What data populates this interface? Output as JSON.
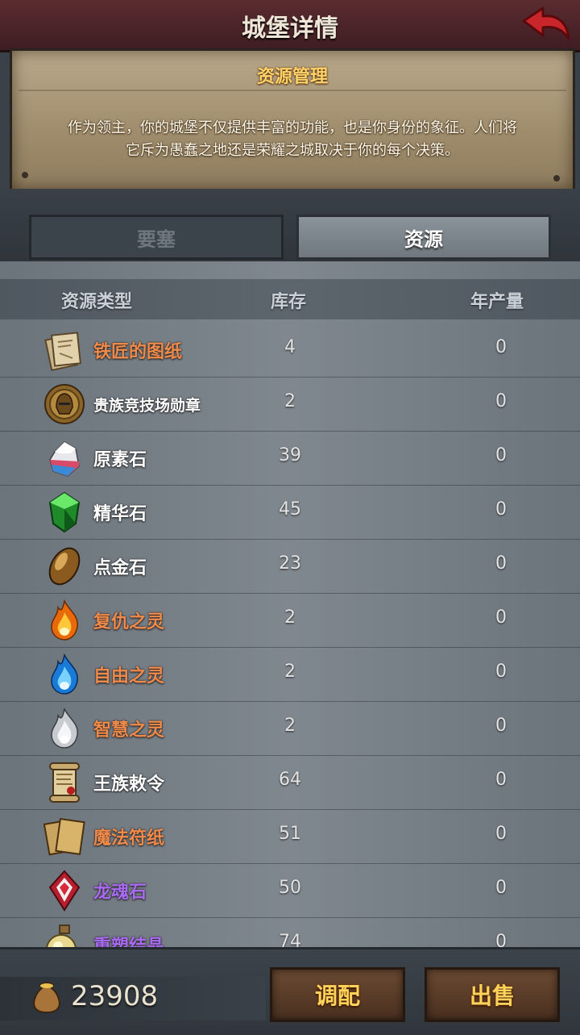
{
  "header": {
    "title": "城堡详情"
  },
  "intro": {
    "title": "资源管理",
    "line1": "作为领主，你的城堡不仅提供丰富的功能，也是你身份的象征。人们将",
    "line2": "它斥为愚蠢之地还是荣耀之城取决于你的每个决策。"
  },
  "tabs": {
    "fortress": "要塞",
    "resources": "资源",
    "active": "resources"
  },
  "table": {
    "headers": {
      "type": "资源类型",
      "stock": "库存",
      "yearly": "年产量"
    },
    "rows": [
      {
        "name": "铁匠的图纸",
        "stock": "4",
        "yearly": "0",
        "color": "#f08a4a",
        "icon": "blueprint-icon"
      },
      {
        "name": "贵族竞技场勋章",
        "stock": "2",
        "yearly": "0",
        "color": "#ffffff",
        "icon": "arena-medal-icon"
      },
      {
        "name": "原素石",
        "stock": "39",
        "yearly": "0",
        "color": "#ffffff",
        "icon": "element-stone-icon"
      },
      {
        "name": "精华石",
        "stock": "45",
        "yearly": "0",
        "color": "#ffffff",
        "icon": "essence-stone-icon"
      },
      {
        "name": "点金石",
        "stock": "23",
        "yearly": "0",
        "color": "#ffffff",
        "icon": "gold-stone-icon"
      },
      {
        "name": "复仇之灵",
        "stock": "2",
        "yearly": "0",
        "color": "#f08a4a",
        "icon": "vengeance-spirit-icon"
      },
      {
        "name": "自由之灵",
        "stock": "2",
        "yearly": "0",
        "color": "#f08a4a",
        "icon": "freedom-spirit-icon"
      },
      {
        "name": "智慧之灵",
        "stock": "2",
        "yearly": "0",
        "color": "#f08a4a",
        "icon": "wisdom-spirit-icon"
      },
      {
        "name": "王族敕令",
        "stock": "64",
        "yearly": "0",
        "color": "#ffffff",
        "icon": "royal-decree-icon"
      },
      {
        "name": "魔法符纸",
        "stock": "51",
        "yearly": "0",
        "color": "#f08a4a",
        "icon": "magic-talisman-icon"
      },
      {
        "name": "龙魂石",
        "stock": "50",
        "yearly": "0",
        "color": "#a86af0",
        "icon": "dragon-soul-stone-icon"
      },
      {
        "name": "重塑结晶",
        "stock": "74",
        "yearly": "0",
        "color": "#a86af0",
        "icon": "reforge-crystal-icon"
      }
    ]
  },
  "footer": {
    "gold": "23908",
    "allocate_label": "调配",
    "sell_label": "出售"
  }
}
